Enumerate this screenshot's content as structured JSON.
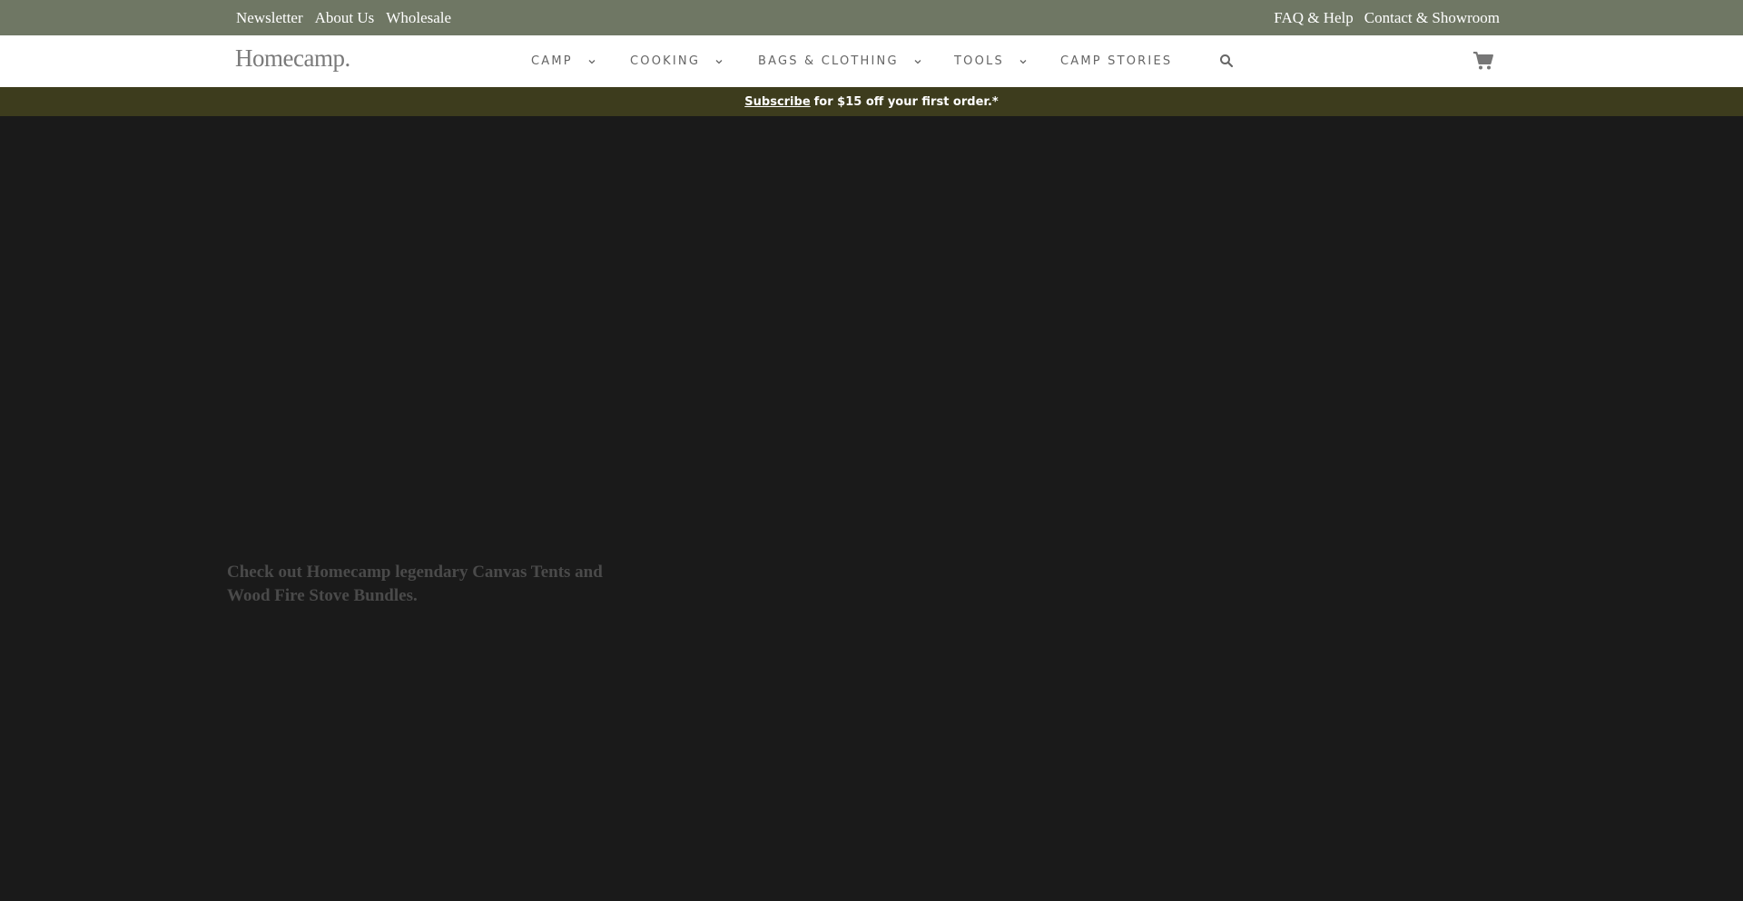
{
  "utility_bar": {
    "left_links": [
      "Newsletter",
      "About Us",
      "Wholesale"
    ],
    "right_links": [
      "FAQ & Help",
      "Contact & Showroom"
    ],
    "background": "#6f7764"
  },
  "header": {
    "logo": "Homecamp.",
    "nav": [
      {
        "label": "CAMP",
        "has_dropdown": true
      },
      {
        "label": "COOKING",
        "has_dropdown": true
      },
      {
        "label": "BAGS & CLOTHING",
        "has_dropdown": true
      },
      {
        "label": "TOOLS",
        "has_dropdown": true
      },
      {
        "label": "CAMP STORIES",
        "has_dropdown": false
      }
    ],
    "search_icon": "search-icon",
    "cart_icon": "cart-icon"
  },
  "promo": {
    "link": "Subscribe",
    "text": "for $15 off your first order.*",
    "background": "#3d3c1d"
  },
  "hero": {
    "text": "Check out Homecamp legendary Canvas Tents and Wood Fire Stove Bundles.",
    "background": "#1a1a1a"
  }
}
